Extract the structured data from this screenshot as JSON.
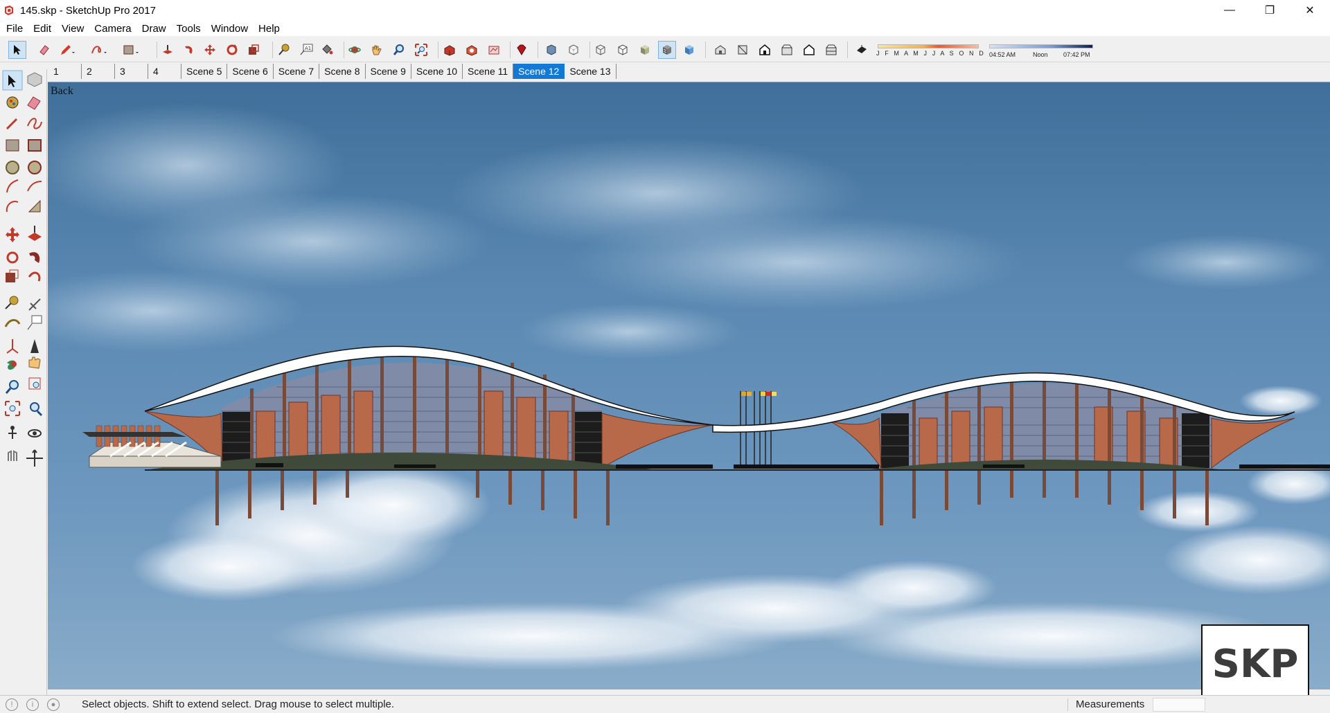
{
  "window": {
    "title": "145.skp - SketchUp Pro 2017",
    "minimize_glyph": "—",
    "maximize_glyph": "❐",
    "close_glyph": "✕"
  },
  "menu": {
    "items": [
      "File",
      "Edit",
      "View",
      "Camera",
      "Draw",
      "Tools",
      "Window",
      "Help"
    ]
  },
  "toolbar": {
    "icons": [
      "select-icon",
      "eraser-icon",
      "pencil-icon",
      "freehand-icon",
      "rectangle-icon",
      "push-pull-icon",
      "follow-me-icon",
      "move-icon",
      "rotate-icon",
      "scale-icon",
      "tape-measure-icon",
      "text-icon",
      "paint-bucket-icon",
      "orbit-icon",
      "pan-icon",
      "zoom-icon",
      "zoom-extents-icon",
      "warehouse-icon",
      "extension-warehouse-icon",
      "send-to-layout-icon",
      "ruby-icon",
      "xray-icon",
      "back-edges-icon",
      "wireframe-icon",
      "hidden-line-icon",
      "shaded-icon",
      "shaded-textures-icon",
      "monochrome-icon",
      "iso-view-icon",
      "top-view-icon",
      "front-view-icon",
      "right-view-icon",
      "back-view-icon",
      "left-view-icon",
      "shadows-toggle-icon"
    ],
    "active_icons": [
      "select-icon",
      "shaded-textures-icon"
    ]
  },
  "shadows": {
    "months": "J F M A M J J A S O N D",
    "time_start": "04:52 AM",
    "time_noon": "Noon",
    "time_end": "07:42 PM"
  },
  "scenes": {
    "tabs": [
      "1",
      "2",
      "3",
      "4",
      "Scene 5",
      "Scene 6",
      "Scene 7",
      "Scene 8",
      "Scene 9",
      "Scene 10",
      "Scene 11",
      "Scene 12",
      "Scene 13"
    ],
    "active": "Scene 12"
  },
  "palette": {
    "tools": [
      "select-tool",
      "component-tool",
      "paint-tool",
      "eraser-tool",
      "line-tool",
      "freehand-tool",
      "rectangle-tool",
      "rotated-rectangle-tool",
      "circle-tool",
      "polygon-tool",
      "arc-tool",
      "two-point-arc-tool",
      "three-point-arc-tool",
      "pie-tool",
      "move-tool",
      "push-pull-tool",
      "rotate-tool",
      "follow-me-tool",
      "scale-tool",
      "offset-tool",
      "tape-measure-tool",
      "dimension-tool",
      "protractor-tool",
      "text-tool",
      "axes-tool",
      "3d-text-tool",
      "orbit-tool",
      "pan-tool",
      "zoom-tool",
      "zoom-window-tool",
      "zoom-extents-tool",
      "previous-view-tool",
      "position-camera-tool",
      "look-around-tool",
      "walk-tool",
      "section-plane-tool"
    ]
  },
  "viewport": {
    "view_label": "Back",
    "watermark": "SKP"
  },
  "status": {
    "hint": "Select objects. Shift to extend select. Drag mouse to select multiple.",
    "measurements_label": "Measurements",
    "measurements_value": ""
  },
  "colors": {
    "active_tab": "#1479d4",
    "roof_white": "#ffffff",
    "panel_brown": "#b8694a",
    "pillar_brown": "#7a4a38",
    "glass_gray": "#7f8ba7"
  }
}
